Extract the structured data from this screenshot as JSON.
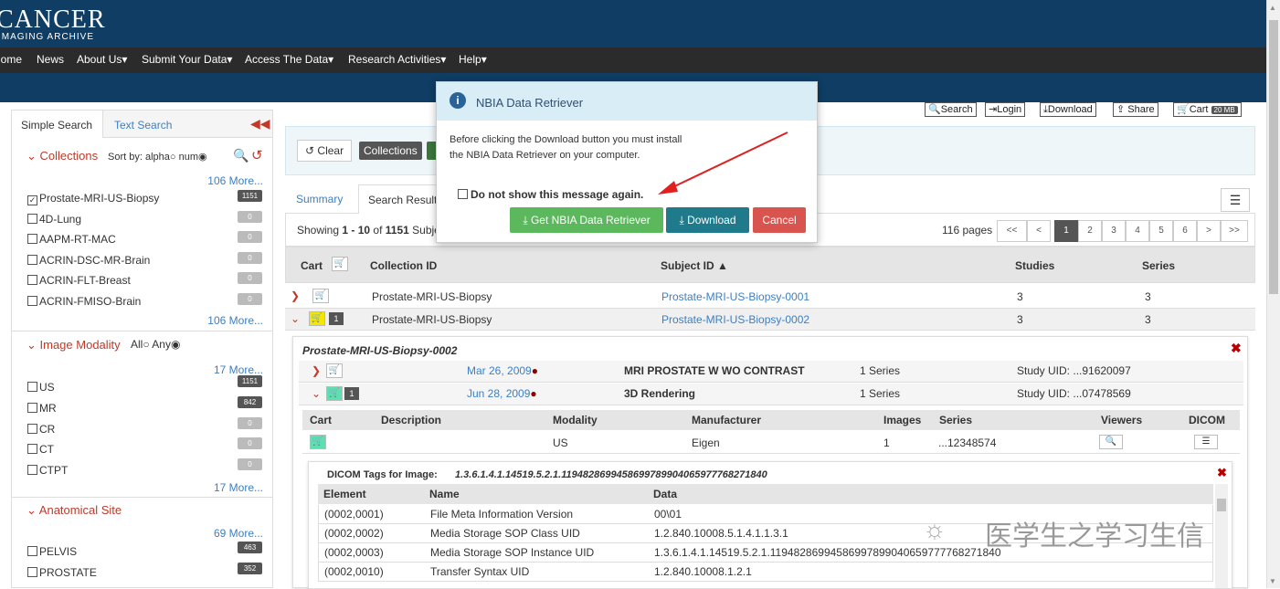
{
  "header": {
    "logo_main": "CANCER",
    "logo_sub": "IMAGING ARCHIVE"
  },
  "nav": [
    "Home",
    "News",
    "About Us",
    "Submit Your Data",
    "Access The Data",
    "Research Activities",
    "Help"
  ],
  "toolbar": {
    "search": "Search",
    "login": "Login",
    "download": "Download",
    "share": "Share",
    "cart": "Cart",
    "cart_size": "20 MB"
  },
  "sidebar": {
    "tabs": [
      "Simple Search",
      "Text Search"
    ],
    "collections": {
      "title": "Collections",
      "sort_label": "Sort by: alpha",
      "num_label": "num",
      "more_top": "106 More...",
      "more_bottom": "106 More...",
      "items": [
        {
          "label": "Prostate-MRI-US-Biopsy",
          "count": "1151",
          "checked": true
        },
        {
          "label": "4D-Lung",
          "count": "0"
        },
        {
          "label": "AAPM-RT-MAC",
          "count": "0"
        },
        {
          "label": "ACRIN-DSC-MR-Brain",
          "count": "0"
        },
        {
          "label": "ACRIN-FLT-Breast",
          "count": "0"
        },
        {
          "label": "ACRIN-FMISO-Brain",
          "count": "0"
        }
      ]
    },
    "modality": {
      "title": "Image Modality",
      "all_label": "All",
      "any_label": "Any",
      "more_top": "17 More...",
      "more_bottom": "17 More...",
      "items": [
        {
          "label": "US",
          "count": "1151"
        },
        {
          "label": "MR",
          "count": "842"
        },
        {
          "label": "CR",
          "count": "0"
        },
        {
          "label": "CT",
          "count": "0"
        },
        {
          "label": "CTPT",
          "count": "0"
        }
      ]
    },
    "anatomical": {
      "title": "Anatomical Site",
      "more": "69 More...",
      "items": [
        {
          "label": "PELVIS",
          "count": "463"
        },
        {
          "label": "PROSTATE",
          "count": "352"
        }
      ]
    }
  },
  "main": {
    "clear": "Clear",
    "collections_btn": "Collections",
    "tabs": [
      "Summary",
      "Search Result"
    ],
    "showing": "Showing",
    "range": "1 - 10",
    "of": "of",
    "total": "1151",
    "subj": "Subje",
    "pages_label": "116 pages",
    "pager": [
      "<<",
      "<",
      "1",
      "2",
      "3",
      "4",
      "5",
      "6",
      ">",
      ">>"
    ],
    "headers": {
      "cart": "Cart",
      "collection": "Collection ID",
      "subject": "Subject ID",
      "studies": "Studies",
      "series": "Series"
    },
    "rows": [
      {
        "collection": "Prostate-MRI-US-Biopsy",
        "subject": "Prostate-MRI-US-Biopsy-0001",
        "studies": "3",
        "series": "3"
      },
      {
        "collection": "Prostate-MRI-US-Biopsy",
        "subject": "Prostate-MRI-US-Biopsy-0002",
        "studies": "3",
        "series": "3",
        "cart_count": "1"
      }
    ],
    "detail": {
      "title": "Prostate-MRI-US-Biopsy-0002",
      "studies": [
        {
          "date": "Mar 26, 2009",
          "desc": "MRI PROSTATE W WO CONTRAST",
          "series": "1 Series",
          "uid": "Study UID: ...91620097"
        },
        {
          "date": "Jun 28, 2009",
          "desc": "3D Rendering",
          "series": "1 Series",
          "uid": "Study UID: ...07478569",
          "cart_count": "1"
        }
      ],
      "series_headers": [
        "Cart",
        "Description",
        "Modality",
        "Manufacturer",
        "Images",
        "Series",
        "Viewers",
        "DICOM"
      ],
      "series_row": {
        "modality": "US",
        "manufacturer": "Eigen",
        "images": "1",
        "series": "...12348574"
      }
    },
    "dicom": {
      "title": "DICOM Tags for Image:",
      "uid": "1.3.6.1.4.1.14519.5.2.1.119482869945869978990406597776827184​0",
      "headers": [
        "Element",
        "Name",
        "Data"
      ],
      "rows": [
        {
          "el": "(0002,0001)",
          "name": "File Meta Information Version",
          "data": "00\\01"
        },
        {
          "el": "(0002,0002)",
          "name": "Media Storage SOP Class UID",
          "data": "1.2.840.10008.5.1.4.1.1.3.1"
        },
        {
          "el": "(0002,0003)",
          "name": "Media Storage SOP Instance UID",
          "data": "1.3.6.1.4.1.14519.5.2.1.1194828699458699789904065977776827184​0"
        },
        {
          "el": "(0002,0010)",
          "name": "Transfer Syntax UID",
          "data": "1.2.840.10008.1.2.1"
        }
      ]
    }
  },
  "modal": {
    "title": "NBIA Data Retriever",
    "message_line1": "Before clicking the Download button you must install",
    "message_line2": "the NBIA Data Retriever on your computer.",
    "checkbox": "Do not show this message again.",
    "btn_get": "Get NBIA Data Retriever",
    "btn_download": "Download",
    "btn_cancel": "Cancel"
  },
  "watermark": "医学生之学习生信",
  "colors": {
    "header": "#0f3d63",
    "nav": "#2b2b2b",
    "green": "#5cb85c",
    "teal": "#1f7a8c",
    "red": "#d9534f",
    "link": "#3b7fc4",
    "accent": "#c0392b"
  }
}
